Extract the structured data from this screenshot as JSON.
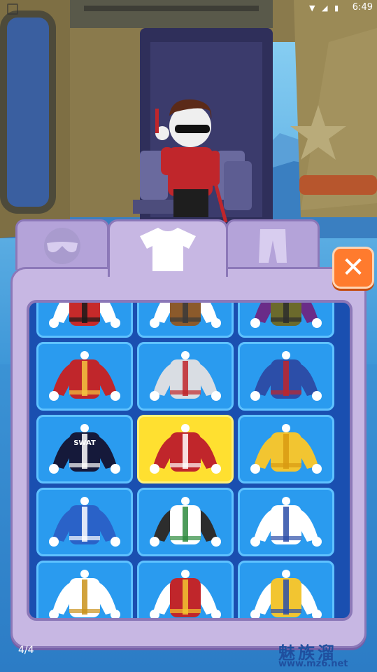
{
  "status_bar": {
    "time": "6:49",
    "icons": [
      "wifi-icon",
      "signal-icon",
      "battery-icon"
    ]
  },
  "tabs": [
    {
      "name": "glasses",
      "icon": "sunglasses-icon",
      "active": false
    },
    {
      "name": "shirts",
      "icon": "tshirt-icon",
      "active": true
    },
    {
      "name": "pants",
      "icon": "pants-icon",
      "active": false
    }
  ],
  "close_icon": "close-icon",
  "outfits": [
    {
      "id": "red-vest",
      "body": "#c62a2a",
      "sleeve": "#ffffff",
      "accent": "#1a1a1a",
      "selected": false
    },
    {
      "id": "brown-utility",
      "body": "#8b5a2b",
      "sleeve": "#ffffff",
      "accent": "#3a3a3a",
      "selected": false
    },
    {
      "id": "olive-purple",
      "body": "#6b6a2c",
      "sleeve": "#6a2c88",
      "accent": "#2d2d2d",
      "selected": false
    },
    {
      "id": "iron-suit",
      "body": "#c0262b",
      "sleeve": "#c0262b",
      "accent": "#f3c640",
      "selected": false
    },
    {
      "id": "silver-jacket",
      "body": "#d9dde3",
      "sleeve": "#d9dde3",
      "accent": "#c0262b",
      "selected": false
    },
    {
      "id": "captain-suit",
      "body": "#2c4ea8",
      "sleeve": "#2c4ea8",
      "accent": "#c0262b",
      "selected": false
    },
    {
      "id": "swat-vest",
      "body": "#15193a",
      "sleeve": "#15193a",
      "accent": "#ffffff",
      "label": "SWAT",
      "selected": false
    },
    {
      "id": "red-jacket",
      "body": "#c0262b",
      "sleeve": "#c0262b",
      "accent": "#ffffff",
      "selected": true
    },
    {
      "id": "yellow-hoodie",
      "body": "#f2c531",
      "sleeve": "#f2c531",
      "accent": "#d99a12",
      "selected": false
    },
    {
      "id": "blue-track",
      "body": "#2a62c8",
      "sleeve": "#2a62c8",
      "accent": "#ffffff",
      "selected": false
    },
    {
      "id": "wrestler-belt",
      "body": "#ffffff",
      "sleeve": "#2d2d2d",
      "accent": "#2e8b3e",
      "selected": false
    },
    {
      "id": "sailor-top",
      "body": "#ffffff",
      "sleeve": "#ffffff",
      "accent": "#2c4ea8",
      "selected": false
    },
    {
      "id": "tattoo-vest",
      "body": "#ffffff",
      "sleeve": "#ffffff",
      "accent": "#c9921b",
      "selected": false
    },
    {
      "id": "red-open-vest",
      "body": "#c0262b",
      "sleeve": "#ffffff",
      "accent": "#f2c531",
      "selected": false
    },
    {
      "id": "yellow-tank",
      "body": "#f2c531",
      "sleeve": "#ffffff",
      "accent": "#2c4ea8",
      "selected": false
    }
  ],
  "page_indicator": "4/4",
  "watermark": {
    "text": "魅族溜",
    "url": "www.mz6.net"
  }
}
